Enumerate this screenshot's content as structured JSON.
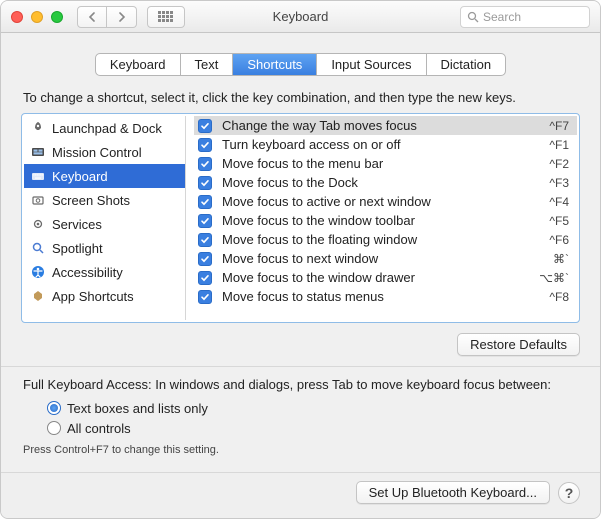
{
  "window": {
    "title": "Keyboard"
  },
  "search": {
    "placeholder": "Search"
  },
  "tabs": [
    {
      "label": "Keyboard"
    },
    {
      "label": "Text"
    },
    {
      "label": "Shortcuts"
    },
    {
      "label": "Input Sources"
    },
    {
      "label": "Dictation"
    }
  ],
  "active_tab_index": 2,
  "instruction": "To change a shortcut, select it, click the key combination, and then type the new keys.",
  "categories": [
    {
      "label": "Launchpad & Dock",
      "icon": "rocket-icon"
    },
    {
      "label": "Mission Control",
      "icon": "mission-icon"
    },
    {
      "label": "Keyboard",
      "icon": "keyboard-icon"
    },
    {
      "label": "Screen Shots",
      "icon": "screenshot-icon"
    },
    {
      "label": "Services",
      "icon": "gear-icon"
    },
    {
      "label": "Spotlight",
      "icon": "spotlight-icon"
    },
    {
      "label": "Accessibility",
      "icon": "accessibility-icon"
    },
    {
      "label": "App Shortcuts",
      "icon": "apps-icon"
    }
  ],
  "selected_category_index": 2,
  "shortcuts": [
    {
      "checked": true,
      "label": "Change the way Tab moves focus",
      "key": "^F7",
      "selected": true
    },
    {
      "checked": true,
      "label": "Turn keyboard access on or off",
      "key": "^F1"
    },
    {
      "checked": true,
      "label": "Move focus to the menu bar",
      "key": "^F2"
    },
    {
      "checked": true,
      "label": "Move focus to the Dock",
      "key": "^F3"
    },
    {
      "checked": true,
      "label": "Move focus to active or next window",
      "key": "^F4"
    },
    {
      "checked": true,
      "label": "Move focus to the window toolbar",
      "key": "^F5"
    },
    {
      "checked": true,
      "label": "Move focus to the floating window",
      "key": "^F6"
    },
    {
      "checked": true,
      "label": "Move focus to next window",
      "key": "⌘`"
    },
    {
      "checked": true,
      "label": "Move focus to the window drawer",
      "key": "⌥⌘`"
    },
    {
      "checked": true,
      "label": "Move focus to status menus",
      "key": "^F8"
    }
  ],
  "restore_label": "Restore Defaults",
  "full_keyboard": {
    "title": "Full Keyboard Access: In windows and dialogs, press Tab to move keyboard focus between:",
    "options": [
      {
        "label": "Text boxes and lists only",
        "selected": true
      },
      {
        "label": "All controls",
        "selected": false
      }
    ],
    "hint": "Press Control+F7 to change this setting."
  },
  "footer": {
    "bluetooth_label": "Set Up Bluetooth Keyboard..."
  }
}
